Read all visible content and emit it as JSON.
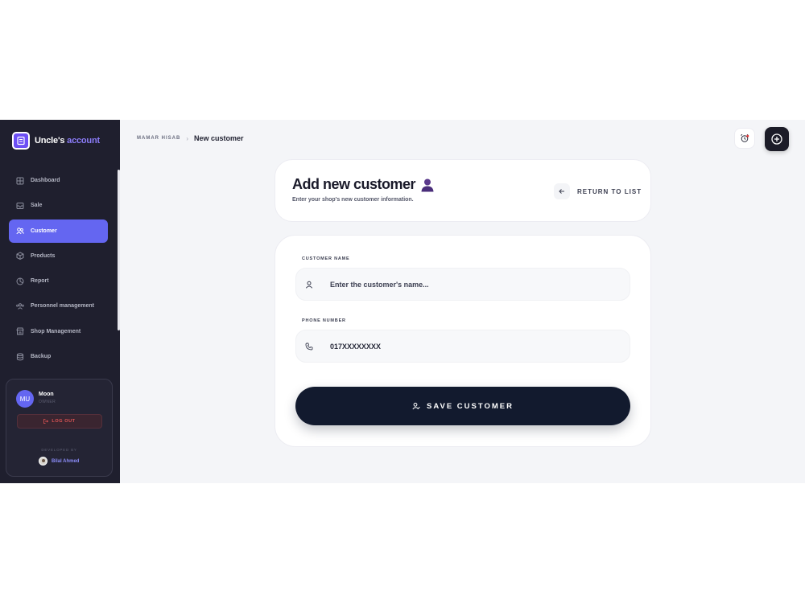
{
  "brand": {
    "name": "Uncle's",
    "accent": "account"
  },
  "sidebar": {
    "items": [
      {
        "label": "Dashboard",
        "icon": "grid-icon"
      },
      {
        "label": "Sale",
        "icon": "inbox-icon"
      },
      {
        "label": "Customer",
        "icon": "users-icon",
        "active": true
      },
      {
        "label": "Products",
        "icon": "box-icon"
      },
      {
        "label": "Report",
        "icon": "pie-chart-icon"
      },
      {
        "label": "Personnel management",
        "icon": "team-icon"
      },
      {
        "label": "Shop Management",
        "icon": "store-icon"
      },
      {
        "label": "Backup",
        "icon": "database-icon"
      }
    ]
  },
  "user": {
    "initials": "MU",
    "name": "Moon",
    "role": "OWNER",
    "logout_label": "LOG OUT",
    "developed_by_label": "DEVELOPED BY",
    "developer_name": "Bilal Ahmed"
  },
  "breadcrumb": {
    "root": "MAMAR HISAB",
    "current": "New customer"
  },
  "header": {
    "title": "Add new customer",
    "subtitle": "Enter your shop's new customer information.",
    "return_label": "RETURN TO LIST"
  },
  "form": {
    "name_label": "CUSTOMER NAME",
    "name_placeholder": "Enter the customer's name...",
    "phone_label": "PHONE NUMBER",
    "phone_value": "017XXXXXXXX",
    "save_label": "SAVE CUSTOMER"
  },
  "colors": {
    "sidebar_bg": "#1f1f2e",
    "accent": "#6466f1",
    "primary_button": "#121a2e",
    "danger": "#e05555"
  }
}
